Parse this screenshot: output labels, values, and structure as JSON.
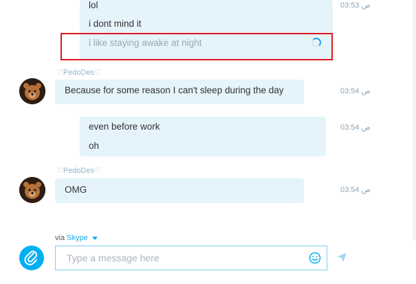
{
  "conversation": {
    "group1": {
      "messages": [
        "lol",
        "i dont mind it",
        "i like staying awake at night"
      ],
      "time": "03:53 ص"
    },
    "group2": {
      "sender": "♡PedoDes♡",
      "message": "Because for some reason I can't sleep during the day",
      "time": "03:54 ص"
    },
    "group3": {
      "messages": [
        "even before work",
        "oh"
      ],
      "time": "03:54 ص"
    },
    "group4": {
      "sender": "♡PedoDes♡",
      "message": "OMG",
      "time": "03:54 ص"
    }
  },
  "composer": {
    "via_label": "via",
    "via_link": "Skype",
    "placeholder": "Type a message here"
  },
  "colors": {
    "accent": "#00aff0",
    "bubble": "#e5f3fb",
    "highlight": "#e0151b"
  }
}
